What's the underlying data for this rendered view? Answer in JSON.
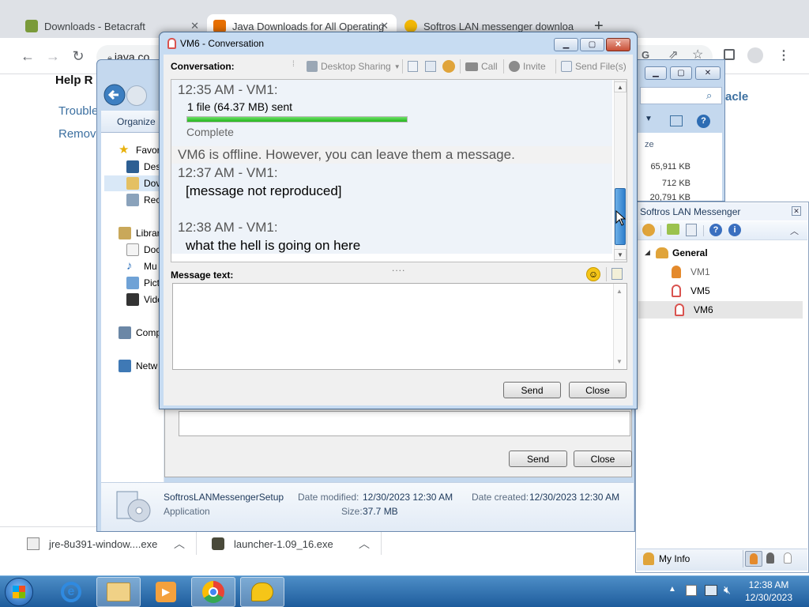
{
  "chrome": {
    "tabs": [
      {
        "title": "Downloads - Betacraft",
        "favicon_color": "#7a9a3a"
      },
      {
        "title": "Java Downloads for All Operating",
        "favicon_color": "#e76f00"
      },
      {
        "title": "Softros LAN messenger downloa",
        "favicon_color": "#f2b705"
      }
    ],
    "new_tab": "+",
    "address": "java.co",
    "page": {
      "help_heading": "Help R",
      "links": [
        "Trouble",
        "Remov"
      ],
      "oracle_fragment": "acle"
    },
    "downloads": [
      {
        "name": "jre-8u391-window....exe"
      },
      {
        "name": "launcher-1.09_16.exe"
      }
    ]
  },
  "explorer": {
    "organize": "Organize",
    "sidebar": [
      {
        "label": "Favor",
        "icon": "star-icon"
      },
      {
        "label": "Des",
        "icon": "desktop-icon"
      },
      {
        "label": "Dov",
        "icon": "downloads-folder-icon"
      },
      {
        "label": "Rec",
        "icon": "recent-places-icon"
      },
      {
        "label": "Librar",
        "icon": "libraries-icon"
      },
      {
        "label": "Doc",
        "icon": "documents-icon"
      },
      {
        "label": "Mu",
        "icon": "music-icon"
      },
      {
        "label": "Pict",
        "icon": "pictures-icon"
      },
      {
        "label": "Vide",
        "icon": "videos-icon"
      },
      {
        "label": "Comp",
        "icon": "computer-icon"
      },
      {
        "label": "Netw",
        "icon": "network-icon"
      }
    ],
    "column_header": "ze",
    "sizes": [
      "65,911 KB",
      "712 KB",
      "20,791 KB"
    ],
    "details": {
      "name": "SoftrosLANMessengerSetup",
      "type": "Application",
      "modified_label": "Date modified:",
      "modified_value": "12/30/2023 12:30 AM",
      "created_label": "Date created:",
      "created_value": "12/30/2023 12:30 AM",
      "size_label": "Size:",
      "size_value": "37.7 MB"
    }
  },
  "back_window": {
    "send": "Send",
    "close": "Close"
  },
  "messenger": {
    "title": "Softros LAN Messenger",
    "group": "General",
    "contacts": [
      {
        "name": "VM1",
        "status": "online",
        "color": "#e48a2c"
      },
      {
        "name": "VM5",
        "status": "offline",
        "color": "#d9534f"
      },
      {
        "name": "VM6",
        "status": "offline",
        "color": "#d9534f"
      }
    ],
    "my_info": "My Info"
  },
  "conversation": {
    "title": "VM6 - Conversation",
    "label": "Conversation:",
    "toolbar": {
      "desktop_sharing": "Desktop Sharing",
      "call": "Call",
      "invite": "Invite",
      "send_files": "Send File(s)"
    },
    "messages": [
      {
        "time": "12:35 AM - VM1:",
        "text": "1 file (64.37 MB) sent",
        "status": "Complete",
        "progress": 1.0
      },
      {
        "notice": "VM6 is offline. However, you can leave them a message."
      },
      {
        "time": "12:37 AM - VM1:",
        "text": "[message not reproduced]"
      },
      {
        "time": "12:38 AM - VM1:",
        "text": "what the hell is going on here"
      }
    ],
    "splitter": "....",
    "message_label": "Message text:",
    "message_value": "",
    "send": "Send",
    "close": "Close"
  },
  "taskbar": {
    "time": "12:38 AM",
    "date": "12/30/2023"
  }
}
